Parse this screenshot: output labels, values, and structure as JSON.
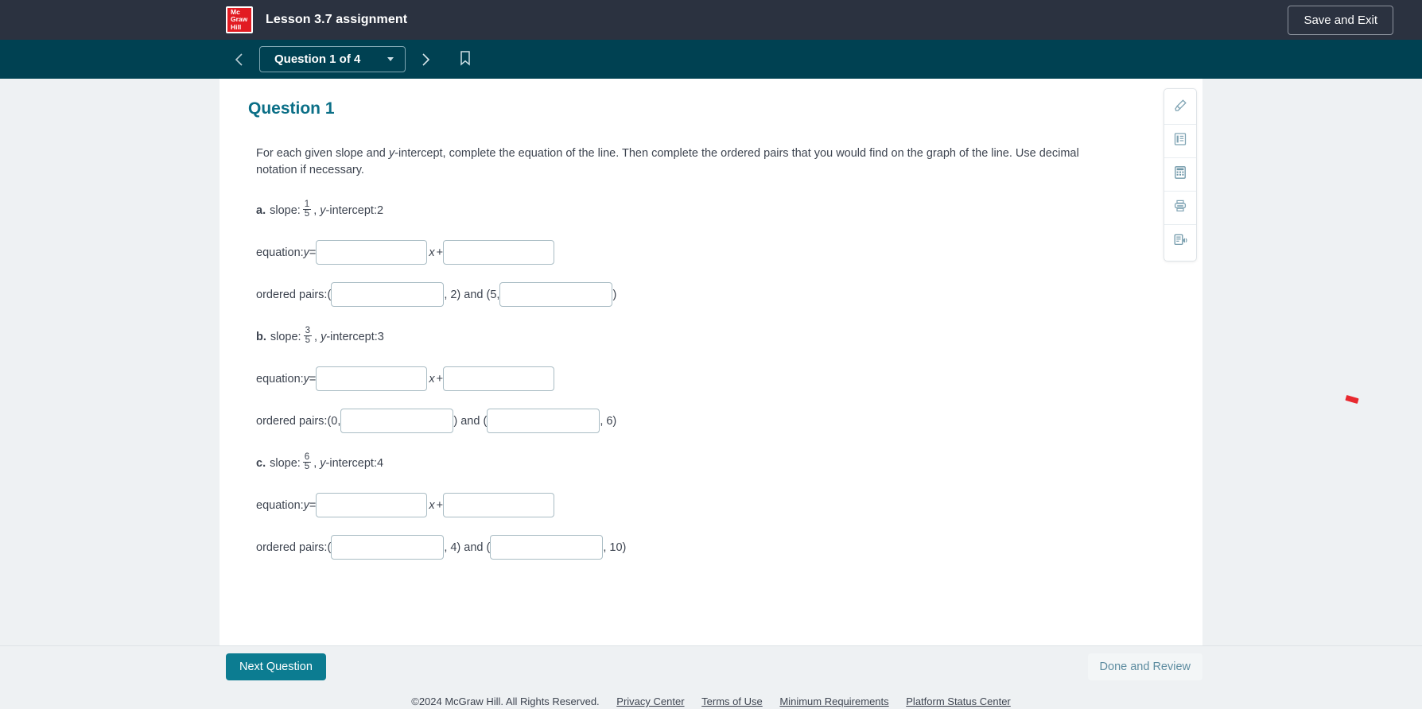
{
  "header": {
    "logo_lines": [
      "Mc",
      "Graw",
      "Hill"
    ],
    "logo_icon": "mcgraw-hill-logo",
    "title": "Lesson 3.7 assignment",
    "save_exit_label": "Save and Exit",
    "bg_color": "#2b3240"
  },
  "nav": {
    "prev_icon": "chevron-left-icon",
    "next_icon": "chevron-right-icon",
    "bookmark_icon": "bookmark-icon",
    "question_selector": "Question 1 of 4",
    "caret_icon": "chevron-down-icon",
    "bg_color": "#004152"
  },
  "question": {
    "heading": "Question 1",
    "heading_color": "#0b6f87",
    "prompt_part1": "For each given slope and ",
    "prompt_italic_y": "y",
    "prompt_part2": "-intercept, complete the equation of the line. Then complete the ordered pairs that you would find on the graph of the line. Use decimal notation if necessary.",
    "equation_label": "equation: ",
    "equation_y": "y",
    "equation_eq": " = ",
    "equation_x": "x",
    "equation_plus": " + ",
    "ordered_label": "ordered pairs: ",
    "parts": [
      {
        "letter": "a.",
        "slope_label": " slope: ",
        "numerator": "1",
        "denominator": "5",
        "intercept_label": "-intercept: ",
        "intercept_value": "2",
        "eq_slope_value": "",
        "eq_slope_placeholder": "",
        "eq_intercept_value": "",
        "pair1_open": "(",
        "pair1_box_value": "",
        "pair1_after": ", 2) and (5,",
        "pair2_box_value": "",
        "pair2_close": ")"
      },
      {
        "letter": "b.",
        "slope_label": " slope: ",
        "numerator": "3",
        "denominator": "5",
        "intercept_label": "-intercept: ",
        "intercept_value": "3",
        "eq_slope_value": "",
        "eq_intercept_value": "",
        "pair1_open": "(0,",
        "pair1_box_value": "",
        "pair1_after": ") and (",
        "pair2_box_value": "",
        "pair2_close": ", 6)"
      },
      {
        "letter": "c.",
        "slope_label": " slope: ",
        "numerator": "6",
        "denominator": "5",
        "intercept_label": "-intercept: ",
        "intercept_value": "4",
        "eq_slope_value": "",
        "eq_intercept_value": "",
        "pair1_open": "(",
        "pair1_box_value": "",
        "pair1_after": ", 4) and (",
        "pair2_box_value": "",
        "pair2_close": ", 10)"
      }
    ]
  },
  "toolbar": {
    "items": [
      {
        "icon": "highlighter-pen-icon",
        "name": "highlighter-tool"
      },
      {
        "icon": "notes-icon",
        "name": "notes-tool"
      },
      {
        "icon": "calculator-icon",
        "name": "calculator-tool"
      },
      {
        "icon": "printer-icon",
        "name": "print-tool"
      },
      {
        "icon": "read-aloud-icon",
        "name": "read-aloud-tool"
      }
    ]
  },
  "footer": {
    "next_question_label": "Next Question",
    "next_question_color": "#0c7c91",
    "done_review_label": "Done and Review",
    "copyright": "©2024 McGraw Hill. All Rights Reserved.",
    "links": [
      "Privacy Center",
      "Terms of Use",
      "Minimum Requirements",
      "Platform Status Center"
    ]
  },
  "annotation": {
    "cursor_mark_color": "#e8292f"
  }
}
